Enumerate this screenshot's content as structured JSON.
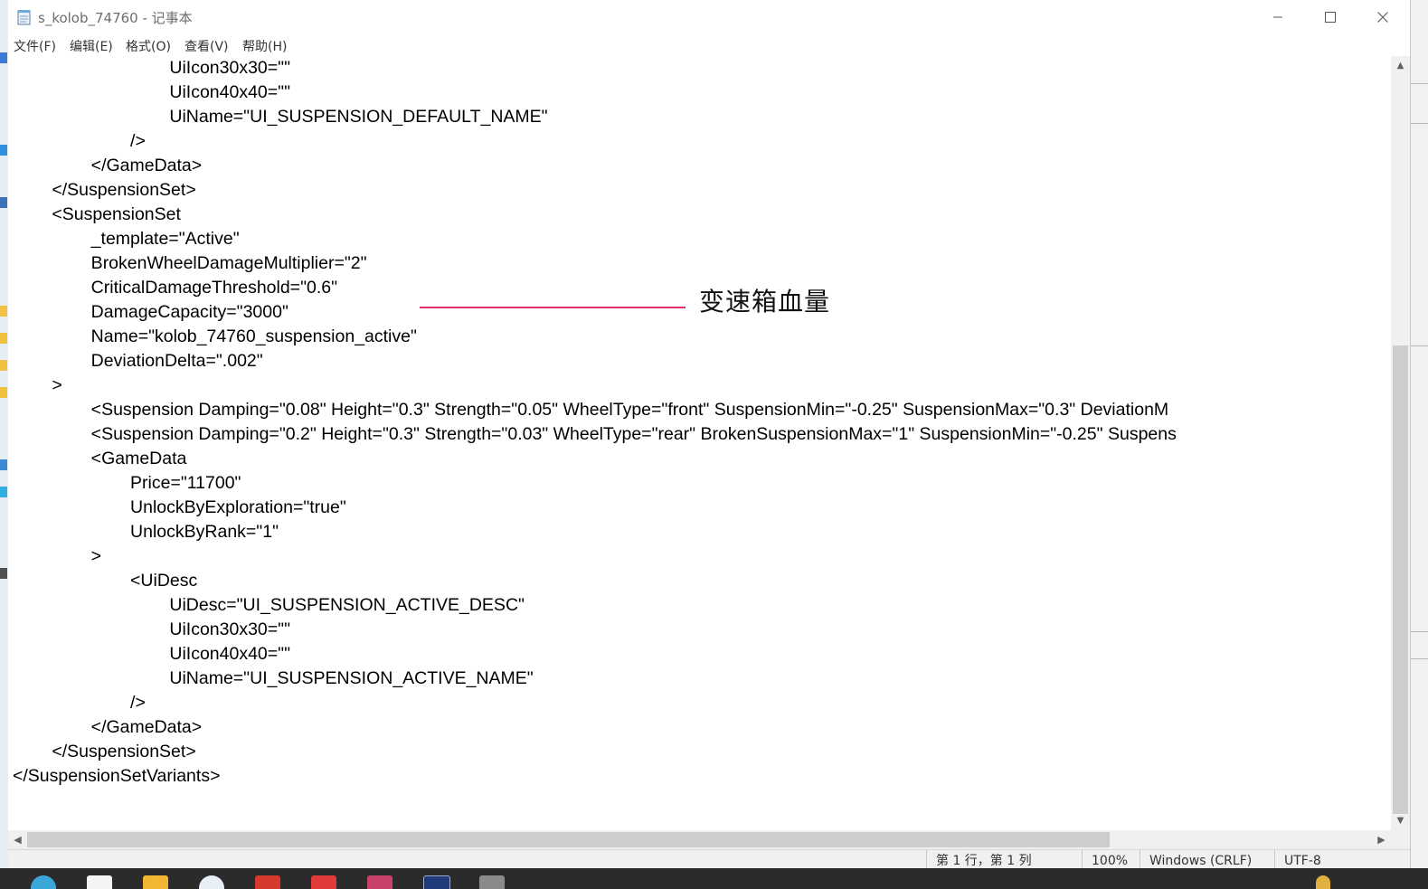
{
  "window": {
    "title": "s_kolob_74760 - 记事本",
    "icon": "notepad-icon"
  },
  "menu": [
    {
      "label": "文件(F)"
    },
    {
      "label": "编辑(E)"
    },
    {
      "label": "格式(O)"
    },
    {
      "label": "查看(V)"
    },
    {
      "label": "帮助(H)"
    }
  ],
  "lines": [
    {
      "text": "                                UiIcon30x30=\"\""
    },
    {
      "text": "                                UiIcon40x40=\"\""
    },
    {
      "text": "                                UiName=\"UI_SUSPENSION_DEFAULT_NAME\""
    },
    {
      "text": "                        />"
    },
    {
      "text": "                </GameData>"
    },
    {
      "text": "        </SuspensionSet>"
    },
    {
      "text": "        <SuspensionSet"
    },
    {
      "text": "                _template=\"Active\""
    },
    {
      "text": "                BrokenWheelDamageMultiplier=\"2\""
    },
    {
      "text": "                CriticalDamageThreshold=\"0.6\""
    },
    {
      "text": "                DamageCapacity=\"3000\""
    },
    {
      "text": "                Name=\"kolob_74760_suspension_active\""
    },
    {
      "text": "                DeviationDelta=\".002\""
    },
    {
      "text": "        >"
    },
    {
      "text": "                <Suspension Damping=\"0.08\" Height=\"0.3\" Strength=\"0.05\" WheelType=\"front\" SuspensionMin=\"-0.25\" SuspensionMax=\"0.3\" DeviationM"
    },
    {
      "text": "                <Suspension Damping=\"0.2\" Height=\"0.3\" Strength=\"0.03\" WheelType=\"rear\" BrokenSuspensionMax=\"1\" SuspensionMin=\"-0.25\" Suspens"
    },
    {
      "text": "                <GameData"
    },
    {
      "text": "                        Price=\"11700\""
    },
    {
      "text": "                        UnlockByExploration=\"true\""
    },
    {
      "text": "                        UnlockByRank=\"1\""
    },
    {
      "text": "                >"
    },
    {
      "text": "                        <UiDesc"
    },
    {
      "text": "                                UiDesc=\"UI_SUSPENSION_ACTIVE_DESC\""
    },
    {
      "text": "                                UiIcon30x30=\"\""
    },
    {
      "text": "                                UiIcon40x40=\"\""
    },
    {
      "text": "                                UiName=\"UI_SUSPENSION_ACTIVE_NAME\""
    },
    {
      "text": "                        />"
    },
    {
      "text": "                </GameData>"
    },
    {
      "text": "        </SuspensionSet>"
    },
    {
      "text": "</SuspensionSetVariants>"
    }
  ],
  "annotation": {
    "text": "变速箱血量",
    "color": "#e0306a"
  },
  "status": {
    "position": "第 1 行，第 1 列",
    "zoom": "100%",
    "line_ending": "Windows (CRLF)",
    "encoding": "UTF-8"
  },
  "colors": {
    "editor_text": "#000000",
    "chrome_bg": "#f0f0f0",
    "taskbar_bg": "#2b2b2b"
  }
}
